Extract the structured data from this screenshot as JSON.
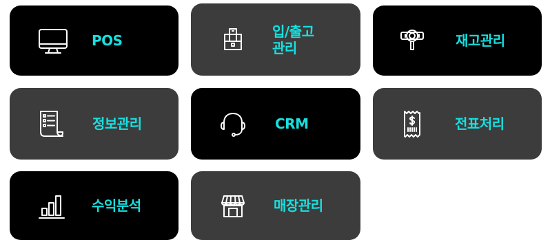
{
  "colors": {
    "accent": "#17e0e0",
    "tile_dark": "#000000",
    "tile_gray": "#3c3c3c",
    "icon": "#ffffff"
  },
  "tiles": [
    {
      "label": "POS",
      "icon": "monitor-icon",
      "style": "dark"
    },
    {
      "label_line1": "입/출고",
      "label_line2": "관리",
      "icon": "package-icon",
      "style": "gray"
    },
    {
      "label": "재고관리",
      "icon": "inventory-scan-icon",
      "style": "dark"
    },
    {
      "label": "정보관리",
      "icon": "document-list-icon",
      "style": "gray"
    },
    {
      "label": "CRM",
      "icon": "headset-icon",
      "style": "dark"
    },
    {
      "label": "전표처리",
      "icon": "receipt-icon",
      "style": "gray"
    },
    {
      "label": "수익분석",
      "icon": "bar-chart-icon",
      "style": "dark"
    },
    {
      "label": "매장관리",
      "icon": "store-icon",
      "style": "gray"
    }
  ]
}
